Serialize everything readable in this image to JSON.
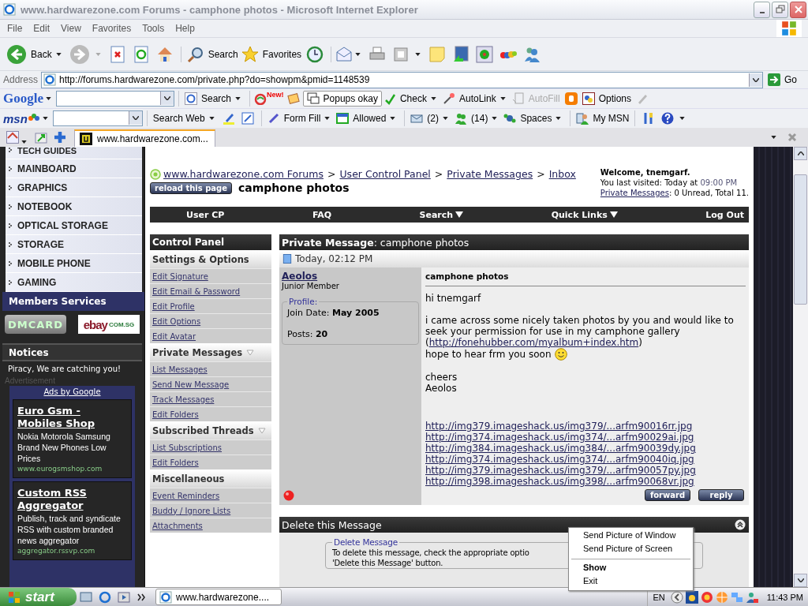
{
  "window": {
    "title": "www.hardwarezone.com Forums - camphone photos - Microsoft Internet Explorer"
  },
  "menu": [
    "File",
    "Edit",
    "View",
    "Favorites",
    "Tools",
    "Help"
  ],
  "toolbar": {
    "back": "Back",
    "search": "Search",
    "favorites": "Favorites"
  },
  "address": {
    "label": "Address",
    "url": "http://forums.hardwarezone.com/private.php?do=showpm&pmid=1148539",
    "go": "Go"
  },
  "google_bar": {
    "brand": "Google",
    "search": "Search",
    "new_badge": "New!",
    "popups": "Popups okay",
    "check": "Check",
    "autolink": "AutoLink",
    "autofill": {
      "label": "AutoFill",
      "disabled": true
    },
    "options": "Options"
  },
  "msn_bar": {
    "brand": "msn",
    "search": "Search Web",
    "form_fill": "Form Fill",
    "allowed": "Allowed",
    "mail": "(2)",
    "contacts": "(14)",
    "spaces": "Spaces",
    "my_msn": "My MSN"
  },
  "tab": {
    "title": "www.hardwarezone.com..."
  },
  "sidebar": {
    "categories": [
      "TECH GUIDES",
      "MAINBOARD",
      "GRAPHICS",
      "NOTEBOOK",
      "OPTICAL STORAGE",
      "STORAGE",
      "MOBILE PHONE",
      "GAMING"
    ],
    "members_title": "Members Services",
    "dmcard": "DMCARD",
    "ebay": "ebay",
    "ebay_suffix": "COM.SG",
    "notices_title": "Notices",
    "notice": "Piracy, We are catching you!",
    "advert_label": "Advertisement",
    "ads_by": "Ads by Google",
    "ads": [
      {
        "title": "Euro Gsm - Mobiles Shop",
        "text": "Nokia Motorola Samsung Brand New Phones Low Prices",
        "url": "www.eurogsmshop.com"
      },
      {
        "title": "Custom RSS Aggregator",
        "text": "Publish, track and syndicate RSS with custom branded news aggregator",
        "url": "aggregator.rssvp.com"
      }
    ]
  },
  "breadcrumb": {
    "links": [
      "www.hardwarezone.com Forums",
      "User Control Panel",
      "Private Messages",
      "Inbox"
    ],
    "separator": ">"
  },
  "reload": "reload this page",
  "page_title": "camphone photos",
  "welcome": {
    "greeting": "Welcome, tnemgarf.",
    "last_visited": "You last visited: Today at",
    "last_time": "09:00 PM",
    "pm_link": "Private Messages",
    "pm_stats": ": 0 Unread, Total 11."
  },
  "navbar": [
    {
      "label": "User CP",
      "dropdown": false
    },
    {
      "label": "FAQ",
      "dropdown": false
    },
    {
      "label": "Search",
      "dropdown": true
    },
    {
      "label": "Quick Links",
      "dropdown": true
    },
    {
      "label": "Log Out",
      "dropdown": false
    }
  ],
  "control_panel": {
    "title": "Control Panel",
    "sections": [
      {
        "title": "Settings & Options",
        "collapsible": false,
        "links": [
          "Edit Signature",
          "Edit Email & Password",
          "Edit Profile",
          "Edit Options",
          "Edit Avatar"
        ]
      },
      {
        "title": "Private Messages",
        "collapsible": true,
        "links": [
          "List Messages",
          "Send New Message",
          "Track Messages",
          "Edit Folders"
        ]
      },
      {
        "title": "Subscribed Threads",
        "collapsible": true,
        "links": [
          "List Subscriptions",
          "Edit Folders"
        ]
      },
      {
        "title": "Miscellaneous",
        "collapsible": false,
        "links": [
          "Event Reminders",
          "Buddy / Ignore Lists",
          "Attachments"
        ]
      }
    ]
  },
  "message": {
    "header": "**Private Message**: camphone photos",
    "date": "Today, 02:12 PM",
    "author": "Aeolos",
    "rank": "Junior Member",
    "online": false,
    "profile_legend": "Profile:",
    "join_label": "Join Date:",
    "join": "May 2005",
    "posts_label": "Posts:",
    "posts": "20",
    "subject": "camphone photos",
    "greeting": "hi tnemgarf",
    "request": "i came across some nicely taken photos by you and would like to seek your permission for use in my camphone gallery",
    "link_open": "(",
    "gallery_link": "http://fonehubber.com/myalbum+index.htm",
    "link_close": ")",
    "closing": "hope to hear frm you soon",
    "smiley": true,
    "signoff": [
      "cheers",
      "Aeolos"
    ],
    "image_links": [
      "http://img379.imageshack.us/img379/...arfm90016rr.jpg",
      "http://img374.imageshack.us/img374/...arfm90029ai.jpg",
      "http://img384.imageshack.us/img384/...arfm90039dy.jpg",
      "http://img374.imageshack.us/img374/...arfm90040iq.jpg",
      "http://img379.imageshack.us/img379/...arfm90057py.jpg",
      "http://img398.imageshack.us/img398/...arfm90068vr.jpg"
    ],
    "buttons": [
      "forward",
      "reply"
    ]
  },
  "delete": {
    "title": "Delete this Message",
    "legend": "Delete Message",
    "lines": [
      "To delete this message, check the appropriate optio",
      "'Delete this Message' button."
    ]
  },
  "context_menu": [
    {
      "kind": "item",
      "label": "Send Picture of Window",
      "default": false
    },
    {
      "kind": "item",
      "label": "Send Picture of Screen",
      "default": false
    },
    {
      "kind": "separator"
    },
    {
      "kind": "item",
      "label": "Show",
      "default": true
    },
    {
      "kind": "item",
      "label": "Exit",
      "default": false
    }
  ],
  "taskbar": {
    "start": "start",
    "task": "www.hardwarezone....",
    "language": "EN",
    "clock": "11:43 PM"
  }
}
